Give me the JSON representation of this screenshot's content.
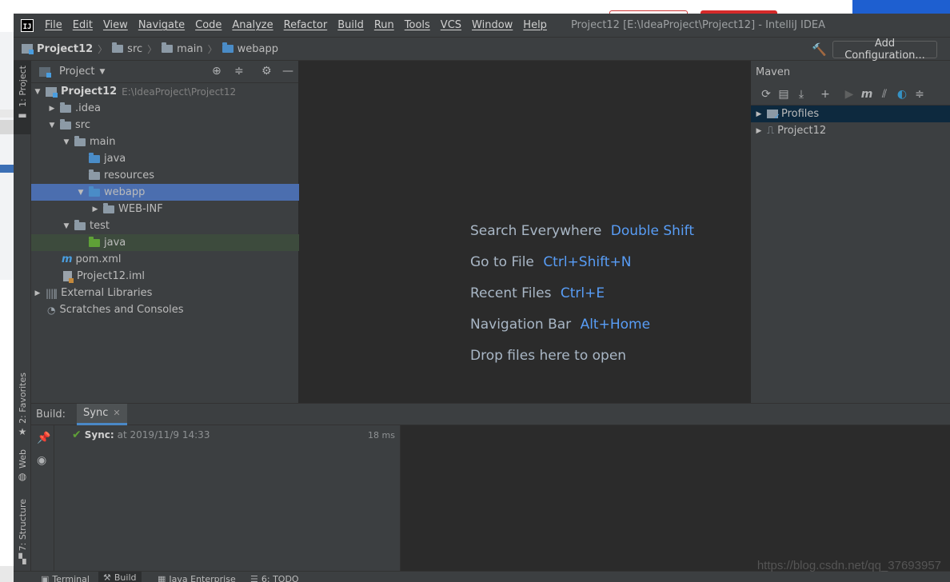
{
  "menu": {
    "items": [
      "File",
      "Edit",
      "View",
      "Navigate",
      "Code",
      "Analyze",
      "Refactor",
      "Build",
      "Run",
      "Tools",
      "VCS",
      "Window",
      "Help"
    ],
    "window_title": "Project12 [E:\\IdeaProject\\Project12] - IntelliJ IDEA"
  },
  "navbar": {
    "crumbs": [
      "Project12",
      "src",
      "main",
      "webapp"
    ],
    "add_config": "Add Configuration..."
  },
  "left_strip": {
    "project": "1: Project",
    "favorites": "2: Favorites",
    "web": "Web",
    "structure": "7: Structure"
  },
  "project_panel": {
    "title": "Project",
    "tree": [
      {
        "label": "Project12",
        "path": "E:\\IdeaProject\\Project12"
      },
      {
        "label": ".idea"
      },
      {
        "label": "src"
      },
      {
        "label": "main"
      },
      {
        "label": "java"
      },
      {
        "label": "resources"
      },
      {
        "label": "webapp"
      },
      {
        "label": "WEB-INF"
      },
      {
        "label": "test"
      },
      {
        "label": "java"
      },
      {
        "label": "pom.xml"
      },
      {
        "label": "Project12.iml"
      },
      {
        "label": "External Libraries"
      },
      {
        "label": "Scratches and Consoles"
      }
    ]
  },
  "editor": {
    "hints": [
      {
        "text": "Search Everywhere",
        "key": "Double Shift"
      },
      {
        "text": "Go to File",
        "key": "Ctrl+Shift+N"
      },
      {
        "text": "Recent Files",
        "key": "Ctrl+E"
      },
      {
        "text": "Navigation Bar",
        "key": "Alt+Home"
      },
      {
        "text": "Drop files here to open",
        "key": ""
      }
    ]
  },
  "maven": {
    "title": "Maven",
    "items": [
      "Profiles",
      "Project12"
    ]
  },
  "build": {
    "label": "Build:",
    "tab": "Sync",
    "sync_name": "Sync:",
    "sync_time": "at 2019/11/9 14:33",
    "duration": "18 ms"
  },
  "bottom_tabs": [
    "Terminal",
    "Build",
    "Java Enterprise",
    "6: TODO"
  ],
  "watermark": "https://blog.csdn.net/qq_37693957"
}
